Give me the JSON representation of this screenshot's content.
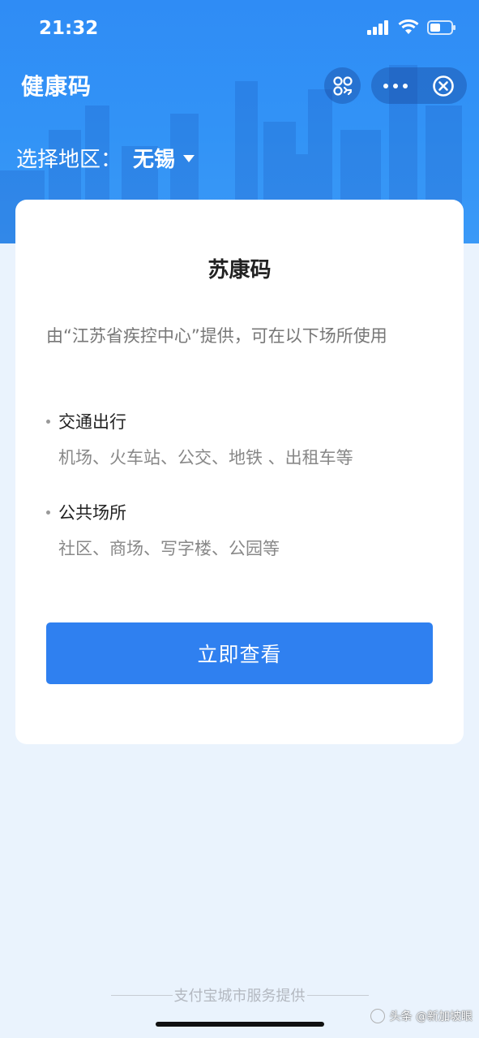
{
  "status_bar": {
    "time": "21:32"
  },
  "nav": {
    "title": "健康码",
    "scan_icon": "scan-icon",
    "more_icon": "more-icon",
    "close_icon": "close-icon"
  },
  "region": {
    "label": "选择地区：",
    "value": "无锡"
  },
  "card": {
    "title": "苏康码",
    "description": "由“江苏省疾控中心”提供，可在以下场所使用",
    "sections": [
      {
        "heading": "交通出行",
        "items": "机场、火车站、公交、地铁 、出租车等"
      },
      {
        "heading": "公共场所",
        "items": "社区、商场、写字楼、公园等"
      }
    ],
    "button_label": "立即查看"
  },
  "footer": {
    "text": "支付宝城市服务提供"
  },
  "watermark": {
    "text": "头条 @新加坡眼"
  },
  "colors": {
    "header_blue": "#2f8cf5",
    "button_blue": "#2f80f0",
    "page_bg": "#eaf3fd"
  }
}
